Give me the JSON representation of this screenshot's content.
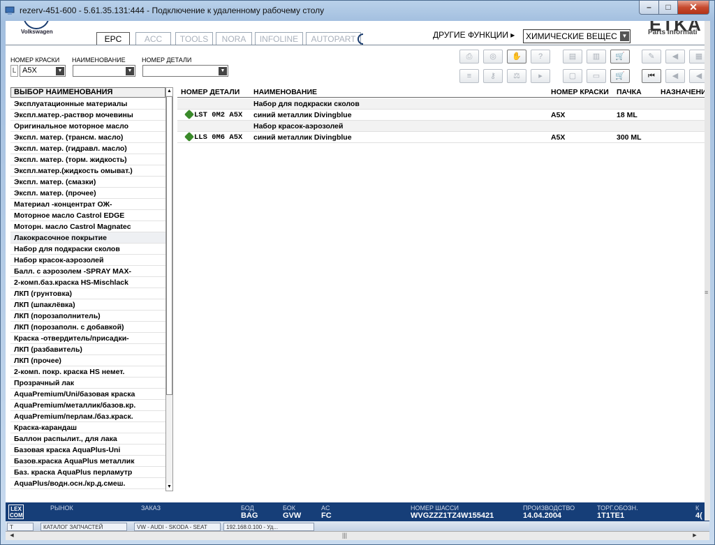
{
  "window": {
    "title": "rezerv-451-600 - 5.61.35.131:444 - Подключение к удаленному рабочему столу",
    "min": "–",
    "max": "□",
    "close": "✕"
  },
  "header": {
    "brand": "Volkswagen",
    "tabs": [
      "EPC",
      "ACC",
      "TOOLS",
      "NORA",
      "INFOLINE",
      "AUTOPART"
    ],
    "active_tab": "EPC",
    "other_functions": "ДРУГИЕ ФУНКЦИИ ▸",
    "category_select": "ХИМИЧЕСКИЕ ВЕЩЕС",
    "etka": "ETKA",
    "parts_info": "Parts Informati"
  },
  "filters": {
    "paint_label": "НОМЕР КРАСКИ",
    "paint_prefix": "L",
    "paint_value": "A5X",
    "name_label": "НАИМЕНОВАНИЕ",
    "part_label": "НОМЕР ДЕТАЛИ"
  },
  "list": {
    "header": "ВЫБОР НАИМЕНОВАНИЯ",
    "items": [
      "Эксплуатационные материалы",
      "Экспл.матер.-раствор мочевины",
      "Оригинальное моторное масло",
      "Экспл. матер. (трансм. масло)",
      "Экспл. матер. (гидравл. масло)",
      "Экспл. матер. (торм. жидкость)",
      "Экспл.матер.(жидкость омыват.)",
      "Экспл. матер. (смазки)",
      "Экспл. матер. (прочее)",
      "Материал -концентрат ОЖ-",
      "Моторное масло Castrol EDGE",
      "Моторн. масло Castrol Magnatec",
      "Лакокрасочное покрытие",
      "Набор для подкраски сколов",
      "Набор красок-аэрозолей",
      "Балл. с аэрозолем  -SPRAY MAX-",
      "2-комп.баз.краска HS-Mischlack",
      "ЛКП (грунтовка)",
      "ЛКП (шпаклёвка)",
      "ЛКП (порозаполнитель)",
      "ЛКП (порозаполн. с добавкой)",
      "Краска -отвердитель/присадки-",
      "ЛКП (разбавитель)",
      "ЛКП (прочее)",
      "2-комп. покр. краска HS немет.",
      "Прозрачный лак",
      "AquaPremium/Uni/базовая краска",
      "AquaPremium/металлик/базов.кр.",
      "AquaPremium/перлам./баз.краск.",
      "Краска-карандаш",
      "Баллон распылит., для лака",
      "Базовая краска AquaPlus-Uni",
      "Базов.краска AquaPlus металлик",
      "Баз. краска AquaPlus перламутр",
      "AquaPlus/водн.осн./кр.д.смеш."
    ],
    "selected_index": 12
  },
  "table": {
    "columns": [
      "НОМЕР ДЕТАЛИ",
      "НАИМЕНОВАНИЕ",
      "НОМЕР КРАСКИ",
      "ПАЧКА",
      "НАЗНАЧЕНИ"
    ],
    "rows": [
      {
        "group": true,
        "name": "Набор для подкраски сколов"
      },
      {
        "group": false,
        "part": "LST 0M2 A5X",
        "name": "синий металлик Divingblue",
        "paint": "A5X",
        "pack": "18 ML"
      },
      {
        "group": true,
        "name": "Набор красок-аэрозолей"
      },
      {
        "group": false,
        "part": "LLS 0M6 A5X",
        "name": "синий металлик Divingblue",
        "paint": "A5X",
        "pack": "300 ML"
      }
    ]
  },
  "status": {
    "market_label": "РЫНОК",
    "order_label": "ЗАКАЗ",
    "bod_label": "БОД",
    "bod": "BAG",
    "bok_label": "БОК",
    "bok": "GVW",
    "ac_label": "AC",
    "ac": "FC",
    "chassis_label": "НОМЕР ШАССИ",
    "chassis": "WVGZZZ1TZ4W155421",
    "prod_label": "ПРОИЗВОДСТВО",
    "prod": "14.04.2004",
    "trade_label": "ТОРГ.ОБОЗН.",
    "trade": "1T1TE1",
    "k_label": "К",
    "k": "4("
  },
  "taskbar": {
    "items": [
      "T",
      "КАТАЛОГ ЗАПЧАСТЕЙ",
      "VW - AUDI - SKODA - SEAT",
      "192.168.0.100 - Уд..."
    ]
  },
  "colors": {
    "status_bar": "#163e78",
    "title_close": "#c74a2f"
  }
}
